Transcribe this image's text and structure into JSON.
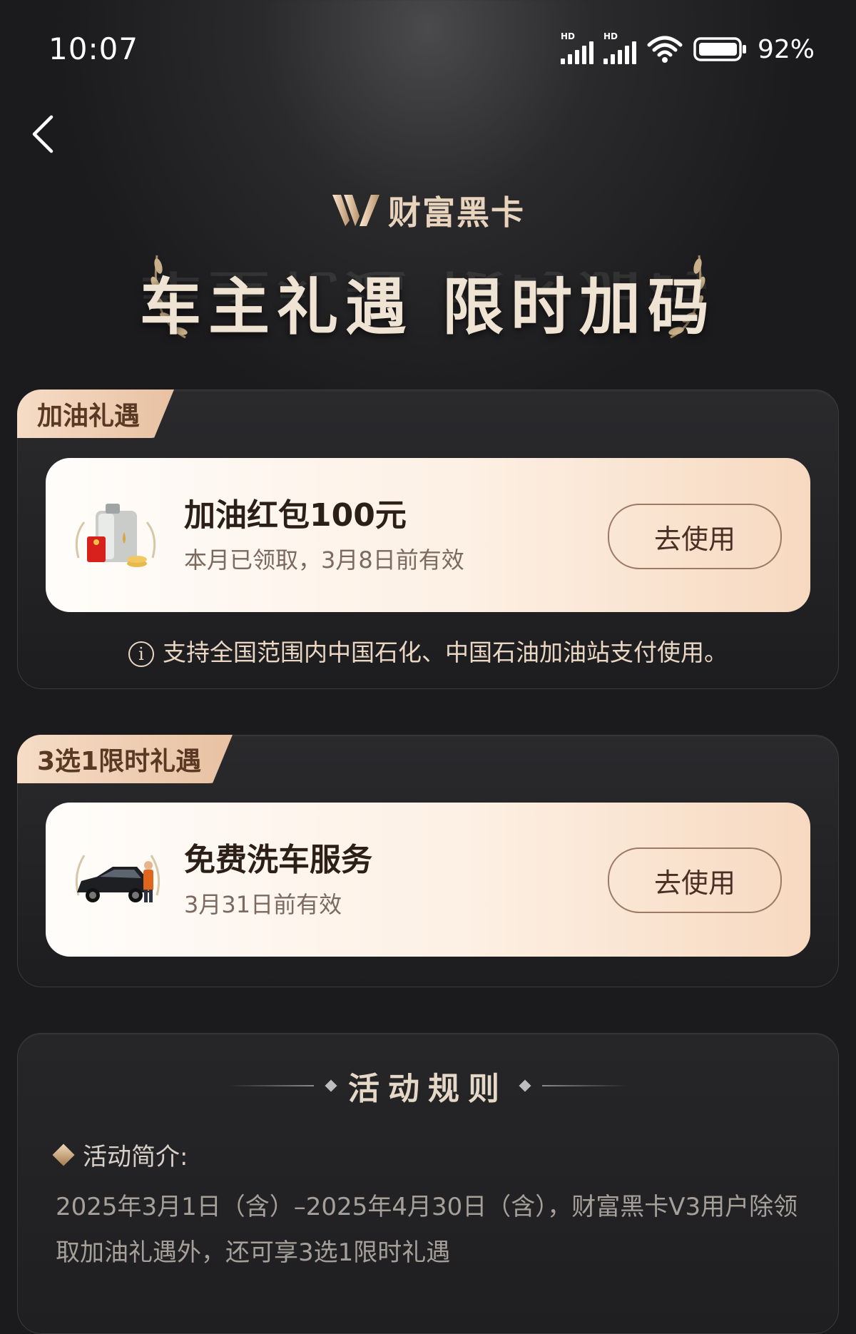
{
  "status_bar": {
    "time": "10:07",
    "signal_label": "HD",
    "battery": "92%"
  },
  "brand": {
    "name": "财富黑卡"
  },
  "hero": {
    "title": "车主礼遇 限时加码"
  },
  "fuel_section": {
    "tab": "加油礼遇",
    "offer": {
      "title": "加油红包100元",
      "subtitle": "本月已领取，3月8日前有效",
      "button": "去使用",
      "icon": "fuel-can-redpacket-icon"
    },
    "note": "支持全国范围内中国石化、中国石油加油站支付使用。"
  },
  "choice_section": {
    "tab": "3选1限时礼遇",
    "offer": {
      "title": "免费洗车服务",
      "subtitle": "3月31日前有效",
      "button": "去使用",
      "icon": "car-wash-icon"
    }
  },
  "rules": {
    "title": "活动规则",
    "intro_label": "活动简介:",
    "intro_text": "2025年3月1日（含）–2025年4月30日（含），财富黑卡V3用户除领取加油礼遇外，还可享3选1限时礼遇"
  },
  "colors": {
    "accent_gold": "#e8c1a2",
    "tab_text": "#5a3924",
    "background": "#1c1c1e"
  }
}
